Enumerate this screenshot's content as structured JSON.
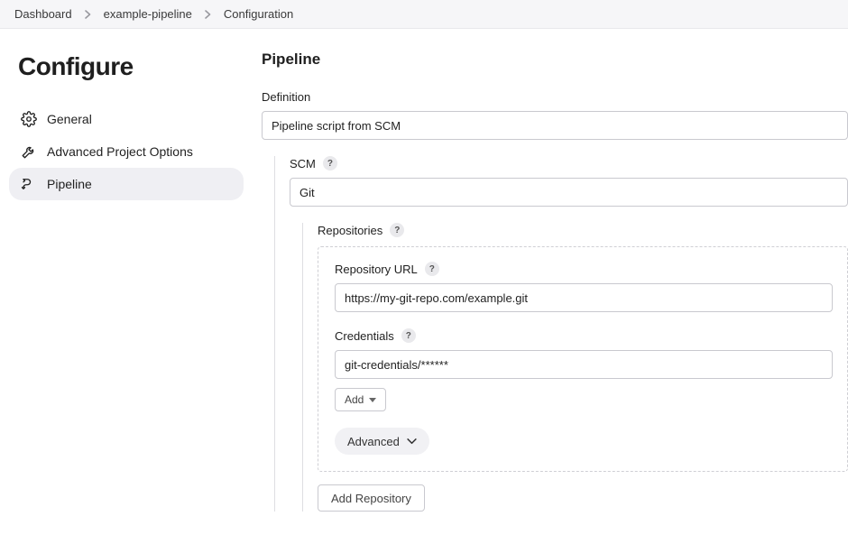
{
  "breadcrumb": {
    "items": [
      "Dashboard",
      "example-pipeline",
      "Configuration"
    ]
  },
  "sidebar": {
    "title": "Configure",
    "items": [
      {
        "key": "general",
        "label": "General",
        "active": false
      },
      {
        "key": "advanced",
        "label": "Advanced Project Options",
        "active": false
      },
      {
        "key": "pipeline",
        "label": "Pipeline",
        "active": true
      }
    ]
  },
  "content": {
    "heading": "Pipeline",
    "definition": {
      "label": "Definition",
      "value": "Pipeline script from SCM"
    },
    "scm": {
      "label": "SCM",
      "value": "Git",
      "repositories": {
        "label": "Repositories",
        "repo_url": {
          "label": "Repository URL",
          "value": "https://my-git-repo.com/example.git"
        },
        "credentials": {
          "label": "Credentials",
          "value": "git-credentials/******"
        },
        "add_button": "Add",
        "advanced_button": "Advanced"
      },
      "add_repository_button": "Add Repository"
    }
  }
}
